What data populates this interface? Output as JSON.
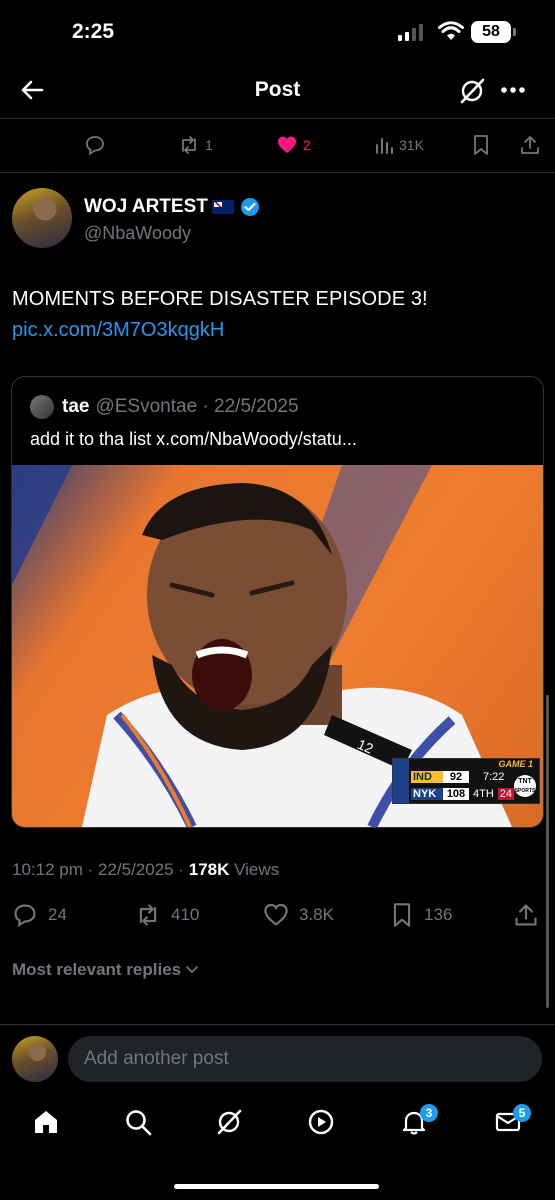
{
  "status_bar": {
    "time": "2:25",
    "battery": "58"
  },
  "header": {
    "title": "Post"
  },
  "parent_actions": {
    "retweets": "1",
    "likes": "2",
    "views": "31K"
  },
  "author": {
    "name": "WOJ ARTEST",
    "handle": "@NbaWoody"
  },
  "post": {
    "text": "MOMENTS BEFORE DISASTER EPISODE 3!",
    "link": "pic.x.com/3M7O3kqgkH"
  },
  "quote": {
    "name": "tae",
    "meta": "@ESvontae · 22/5/2025",
    "text": "add it to tha list x.com/NbaWoody/statu...",
    "image": {
      "jersey_number": "12",
      "scorebug": {
        "game": "GAME 1",
        "team1": "IND",
        "score1": "92",
        "team2": "NYK",
        "score2": "108",
        "clock": "7:22",
        "quarter": "4TH",
        "shot_clock": "24",
        "network": "TNT",
        "network_sub": "SPORTS"
      }
    }
  },
  "meta": {
    "time": "10:12 pm · 22/5/2025 ·",
    "views_count": "178K",
    "views_label": "Views"
  },
  "actions": {
    "replies": "24",
    "reposts": "410",
    "likes": "3.8K",
    "bookmarks": "136"
  },
  "replies_sort": {
    "label": "Most relevant replies"
  },
  "reply_box": {
    "placeholder": "Add another post"
  },
  "tab_bar": {
    "notifications_badge": "3",
    "messages_badge": "5"
  },
  "colors": {
    "accent": "#1d9bf0",
    "like_pink": "#f91880"
  }
}
